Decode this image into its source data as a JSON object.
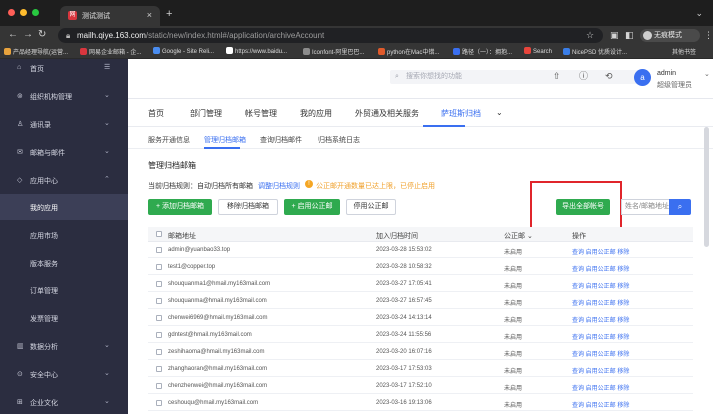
{
  "browser": {
    "tab_title": "测试测试",
    "tab_favicon": "网",
    "url_host": "mailh.qiye.163.com",
    "url_path": "/static/new/index.html#/application/archiveAccount",
    "profile_label": "无痕模式",
    "bookmarks": [
      "产品经理导航(运营...",
      "网易企业邮箱 - 企...",
      "Google - Site Reli...",
      "https://www.baidu...",
      "Iconfont-阿里巴巴...",
      "python在Mac中错...",
      "路径（一）：拥抱...",
      "Search",
      "NicePSD 优质设计...",
      "其他书签"
    ]
  },
  "sidebar": {
    "items": [
      {
        "label": "首页",
        "icon": "home-icon"
      },
      {
        "label": "组织机构管理",
        "icon": "org-icon"
      },
      {
        "label": "通讯录",
        "icon": "contacts-icon"
      },
      {
        "label": "邮箱与邮件",
        "icon": "mail-icon"
      },
      {
        "label": "应用中心",
        "icon": "app-icon"
      },
      {
        "label": "我的应用"
      },
      {
        "label": "应用市场"
      },
      {
        "label": "版本服务"
      },
      {
        "label": "订单管理"
      },
      {
        "label": "发票管理"
      },
      {
        "label": "数据分析",
        "icon": "chart-icon"
      },
      {
        "label": "安全中心",
        "icon": "shield-icon"
      },
      {
        "label": "企业文化",
        "icon": "culture-icon"
      }
    ]
  },
  "topbar": {
    "search_placeholder": "搜索你想找的功能",
    "avatar_text": "a",
    "admin_name": "admin",
    "admin_role": "超级管理员"
  },
  "nav": {
    "items": [
      "首页",
      "部门管理",
      "帐号管理",
      "我的应用",
      "外贸通及相关服务",
      "萨班斯归档"
    ],
    "more_icon": "chevron-down-icon"
  },
  "subtabs": [
    "服务开通信息",
    "管理归档邮箱",
    "查询归档邮件",
    "归档系统日志"
  ],
  "section_title": "管理归档邮箱",
  "rule": {
    "text": "当前归档规则：自动归档所有邮箱",
    "link": "调整归档规则",
    "warning": "公正邮开通数量已达上限，已停止启用"
  },
  "buttons": {
    "add": "+ 添加归档邮箱",
    "remove": "移除归档邮箱",
    "enable": "+ 启用公正邮",
    "disable": "停用公正邮",
    "export": "导出全部帐号",
    "name_search_placeholder": "姓名/邮箱地址"
  },
  "table": {
    "headers": [
      "邮箱地址",
      "加入归档时间",
      "公正邮 ⌄",
      "操作"
    ],
    "rows": [
      {
        "email": "admin@yuanbao33.top",
        "time": "2023-03-28 15:53:02",
        "status": "未启用",
        "ops": "查询 启用公正邮 移除"
      },
      {
        "email": "test1@copper.top",
        "time": "2023-03-28 10:58:32",
        "status": "未启用",
        "ops": "查询 启用公正邮 移除"
      },
      {
        "email": "shouquanma1@hmail.my163mail.com",
        "time": "2023-03-27 17:05:41",
        "status": "未启用",
        "ops": "查询 启用公正邮 移除"
      },
      {
        "email": "shouquanma@hmail.my163mail.com",
        "time": "2023-03-27 16:57:45",
        "status": "未启用",
        "ops": "查询 启用公正邮 移除"
      },
      {
        "email": "chenwei6969@hmail.my163mail.com",
        "time": "2023-03-24 14:13:14",
        "status": "未启用",
        "ops": "查询 启用公正邮 移除"
      },
      {
        "email": "gdntest@hmail.my163mail.com",
        "time": "2023-03-24 11:55:56",
        "status": "未启用",
        "ops": "查询 启用公正邮 移除"
      },
      {
        "email": "zeshihaoma@hmail.my163mail.com",
        "time": "2023-03-20 16:07:16",
        "status": "未启用",
        "ops": "查询 启用公正邮 移除"
      },
      {
        "email": "zhanghaoran@hmail.my163mail.com",
        "time": "2023-03-17 17:53:03",
        "status": "未启用",
        "ops": "查询 启用公正邮 移除"
      },
      {
        "email": "chenzhenwei@hmail.my163mail.com",
        "time": "2023-03-17 17:52:10",
        "status": "未启用",
        "ops": "查询 启用公正邮 移除"
      },
      {
        "email": "ceshouqu@hmail.my163mail.com",
        "time": "2023-03-16 19:13:06",
        "status": "未启用",
        "ops": "查询 启用公正邮 移除"
      }
    ]
  },
  "colors": {
    "accent": "#3a6ff0",
    "sidebar": "#2b2d40",
    "green": "#2faa4f",
    "highlight": "#e0252b",
    "warning": "#f0a22e"
  }
}
